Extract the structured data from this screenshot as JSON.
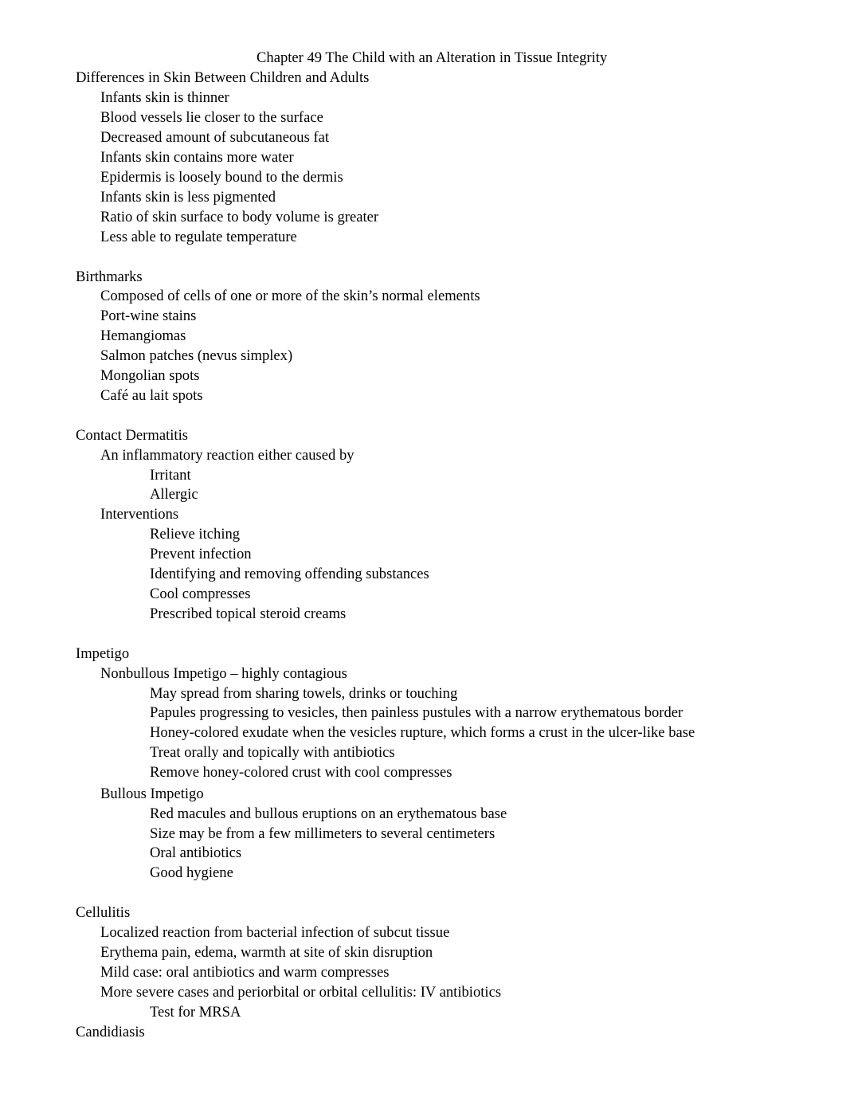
{
  "document": {
    "title": "Chapter 49  The Child with an Alteration in Tissue Integrity",
    "sections": [
      {
        "heading": "Differences in Skin Between Children and Adults",
        "items": [
          "Infants skin is thinner",
          "Blood vessels lie closer to the surface",
          "Decreased amount of subcutaneous fat",
          "Infants skin contains more water",
          "Epidermis is loosely bound to the dermis",
          "Infants skin is less pigmented",
          "Ratio of skin surface to body volume is greater",
          "Less able to regulate temperature"
        ]
      },
      {
        "heading": "Birthmarks",
        "items": [
          "Composed of cells of one or more of the skin’s normal elements",
          "Port-wine stains",
          "Hemangiomas",
          "Salmon patches (nevus simplex)",
          "Mongolian spots",
          "Café au lait spots"
        ]
      },
      {
        "heading": "Contact Dermatitis",
        "items": [
          {
            "text": "An inflammatory reaction either caused by",
            "subitems": [
              "Irritant",
              "Allergic"
            ]
          },
          {
            "text": "Interventions",
            "subitems": [
              "Relieve itching",
              "Prevent infection",
              "Identifying and removing offending substances",
              "Cool compresses",
              "Prescribed topical steroid creams"
            ]
          }
        ]
      },
      {
        "heading": "Impetigo",
        "items": [
          {
            "text": "Nonbullous Impetigo – highly contagious",
            "subitems": [
              "May spread from sharing towels, drinks or touching",
              "Papules progressing to vesicles, then painless pustules with a narrow erythematous border",
              "Honey-colored exudate when the vesicles rupture, which forms a crust in the ulcer-like base",
              "Treat orally and topically with antibiotics",
              "Remove honey-colored crust with cool compresses"
            ]
          },
          {
            "text": "Bullous Impetigo",
            "subitems": [
              "Red macules and bullous eruptions on an erythematous base",
              "Size may be from a few millimeters to several centimeters",
              "Oral antibiotics",
              "Good hygiene"
            ]
          }
        ]
      },
      {
        "heading": "Cellulitis",
        "items": [
          {
            "text": "Localized reaction from bacterial infection of subcut tissue",
            "subitems": []
          },
          {
            "text": "Erythema pain, edema, warmth at site of skin disruption",
            "subitems": []
          },
          {
            "text": "Mild case: oral antibiotics and warm compresses",
            "subitems": []
          },
          {
            "text": "More severe cases and periorbital or orbital cellulitis: IV antibiotics",
            "subitems": [
              "Test for MRSA"
            ]
          }
        ]
      },
      {
        "heading": "Candidiasis",
        "items": []
      }
    ]
  }
}
